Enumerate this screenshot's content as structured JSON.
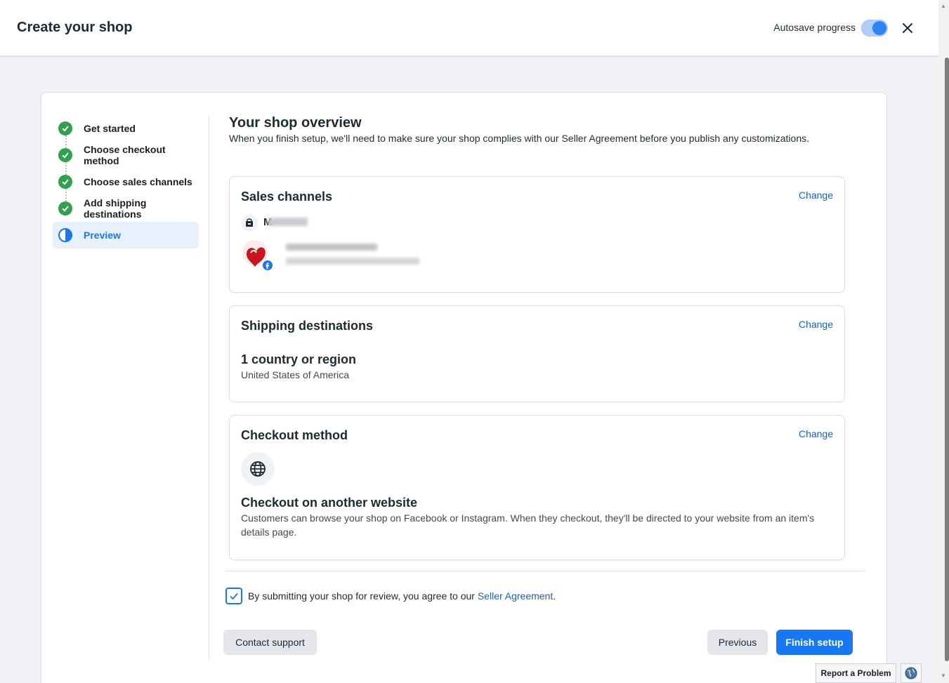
{
  "header": {
    "title": "Create your shop",
    "autosave_label": "Autosave progress"
  },
  "steps": [
    {
      "label": "Get started",
      "status": "complete"
    },
    {
      "label": "Choose checkout method",
      "status": "complete"
    },
    {
      "label": "Choose sales channels",
      "status": "complete"
    },
    {
      "label": "Add shipping destinations",
      "status": "complete"
    },
    {
      "label": "Preview",
      "status": "in-progress"
    }
  ],
  "overview": {
    "title": "Your shop overview",
    "subtitle": "When you finish setup, we'll need to make sure your shop complies with our Seller Agreement before you publish any customizations."
  },
  "sales_channels": {
    "heading": "Sales channels",
    "change_label": "Change",
    "channel_initial": "M"
  },
  "shipping": {
    "heading": "Shipping destinations",
    "change_label": "Change",
    "count_text": "1 country or region",
    "countries": "United States of America"
  },
  "checkout": {
    "heading": "Checkout method",
    "change_label": "Change",
    "method_title": "Checkout on another website",
    "method_desc": "Customers can browse your shop on Facebook or Instagram. When they checkout, they'll be directed to your website from an item's details page."
  },
  "agreement": {
    "checked": true,
    "text": "By submitting your shop for review, you agree to our ",
    "link": "Seller Agreement",
    "suffix": "."
  },
  "buttons": {
    "contact": "Contact support",
    "previous": "Previous",
    "finish": "Finish setup"
  },
  "footer": {
    "report": "Report a Problem"
  },
  "colors": {
    "accent": "#1877f2",
    "success": "#31a24c",
    "link": "#1b5fbd"
  }
}
